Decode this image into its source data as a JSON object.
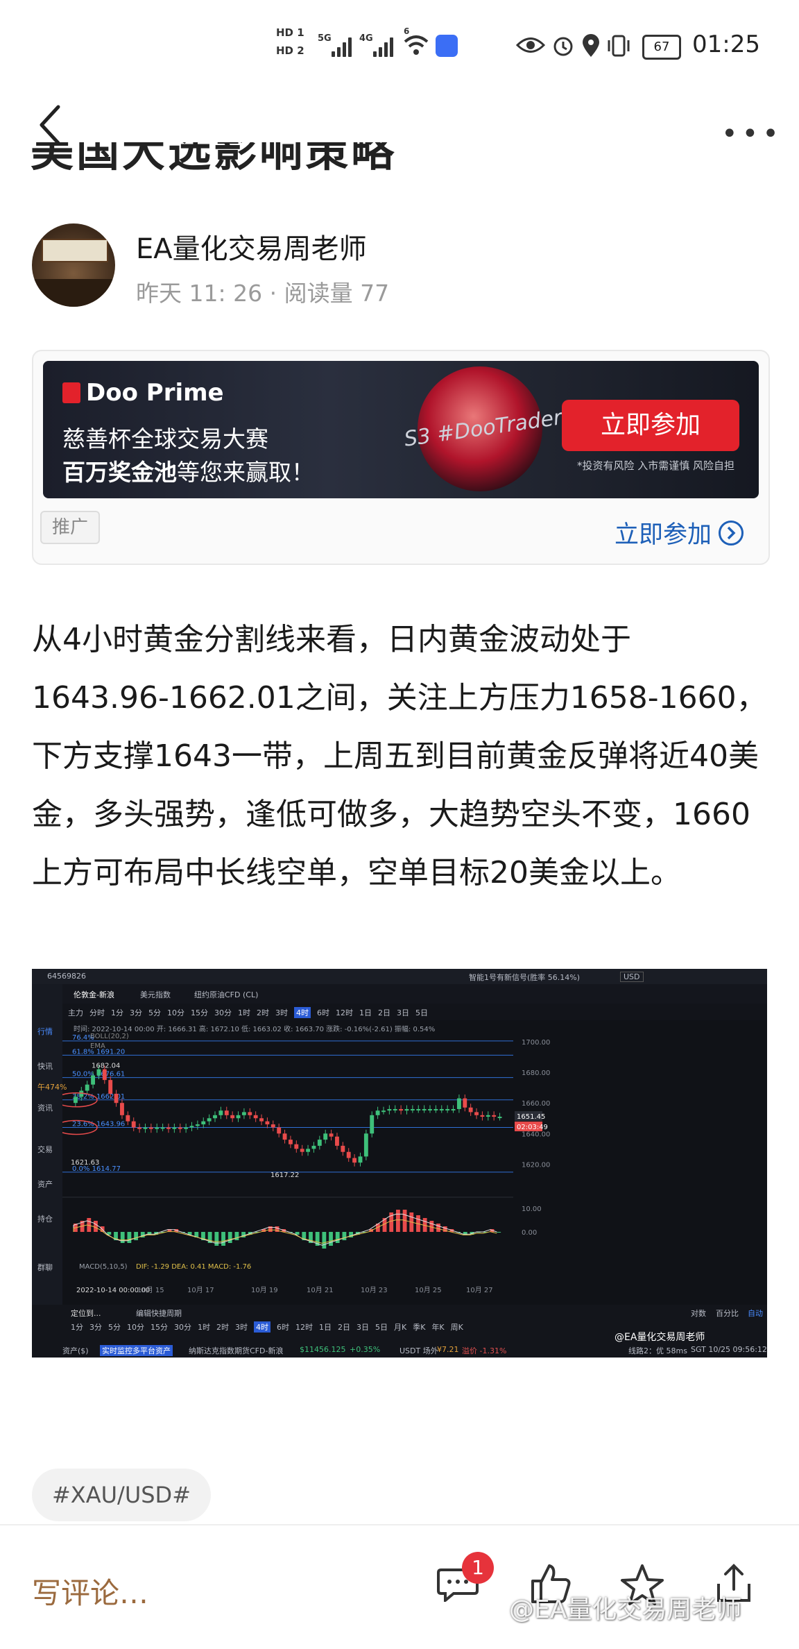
{
  "status_bar": {
    "hd1": "HD 1",
    "hd2": "HD 2",
    "net1": "5G",
    "net2": "4G",
    "wifi": "6",
    "battery": "67",
    "time": "01:25"
  },
  "nav": {
    "back_icon": "chevron-left-icon",
    "more_icon": "more-dots-icon"
  },
  "title_fragment": "美国大选影响策略",
  "author": {
    "name": "EA量化交易周老师",
    "date": "昨天 11: 26",
    "reads": "阅读量 77",
    "separator": "·"
  },
  "ad": {
    "brand": "Doo Prime",
    "line1": "慈善杯全球交易大赛",
    "line2_bold": "百万奖金池",
    "line2_rest": "等您来赢取！",
    "hashtag": "S3 #DooTrader",
    "join_button": "立即参加",
    "risk": "*投资有风险 入市需谨慎 风险自担",
    "promo_label": "推广",
    "cta": "立即参加"
  },
  "article": {
    "text": "从4小时黄金分割线来看，日内黄金波动处于1643.96-1662.01之间，关注上方压力1658-1660，下方支撑1643一带，上周五到目前黄金反弹将近40美金，多头强势，逢低可做多，大趋势空头不变，1660上方可布局中长线空单，空单目标20美金以上。"
  },
  "trading_screenshot": {
    "account": "64569826",
    "signal": "智能1号有新信号(胜率 56.14%)",
    "currency": "USD",
    "tabs": [
      "伦敦金-新浪",
      "美元指数",
      "纽约原油CFD (CL)"
    ],
    "side_items": [
      "行情",
      "快讯",
      "资讯",
      "交易",
      "资产",
      "持仓",
      "群聊"
    ],
    "side_note": "午474%",
    "timeframes": [
      "主力",
      "分时",
      "1分",
      "3分",
      "5分",
      "10分",
      "15分",
      "30分",
      "1时",
      "2时",
      "3时",
      "4时",
      "6时",
      "12时",
      "1日",
      "2日",
      "3日",
      "5日"
    ],
    "active_tf": "4时",
    "ohlc": "时间: 2022-10-14 00:00  开: 1666.31  高: 1672.10  低: 1663.02  收: 1663.70  涨跌: -0.16%(-2.61)  振幅: 0.54%",
    "indicators": [
      "BOLL(20,2)",
      "EMA"
    ],
    "fib_levels": [
      "76.4%",
      "61.8% 1691.20",
      "50.0% 1676.61",
      "38.2% 1662.01",
      "23.6% 1643.96",
      "0.0% 1614.77"
    ],
    "price_labels": [
      "1682.04",
      "1621.63",
      "1617.22"
    ],
    "y_axis": [
      "1700.00",
      "1680.00",
      "1660.00",
      "1640.00",
      "1620.00"
    ],
    "current_price": "1651.45",
    "countdown": "02:03:49",
    "macd_label": "MACD(5,10,5)",
    "macd_values": "DIF: -1.29  DEA: 0.41  MACD: -1.76",
    "macd_axis": [
      "10.00",
      "0.00"
    ],
    "x_axis": [
      "2022-10-14 00:00:00",
      "10月 15",
      "10月 17",
      "10月 19",
      "10月 21",
      "10月 23",
      "10月 25",
      "10月 27"
    ],
    "bottom_tfs": [
      "1分",
      "3分",
      "5分",
      "10分",
      "15分",
      "30分",
      "1时",
      "2时",
      "3时",
      "4时",
      "6时",
      "12时",
      "1日",
      "2日",
      "3日",
      "5日",
      "月K",
      "季K",
      "年K",
      "周K"
    ],
    "bottom_left": "定位到...",
    "bottom_hint": "编辑快捷周期",
    "log_label": "对数",
    "percent_label": "百分比",
    "auto_label": "自动",
    "watermark": "@EA量化交易周老师",
    "asset_label": "资产($)",
    "asset_btn": "实时监控多平台资产",
    "ticker": "纳斯达克指数期货CFD-新浪",
    "ticker_price": "$11456.125",
    "ticker_change": "+0.35%",
    "usdt": "USDT 场外",
    "usdt_price": "¥7.21",
    "usdt_change": "溢价 -1.31%",
    "line_info": "线路2：优 58ms",
    "sgt": "SGT 10/25 09:56:12"
  },
  "tag": "#XAU/USD#",
  "bottom_bar": {
    "comment_placeholder": "写评论…",
    "comment_count": "1",
    "watermark": "@EA量化交易周老师"
  },
  "colors": {
    "brand_red": "#e3222b",
    "link_blue": "#1e60b8",
    "comment_brown": "#9b6a3e",
    "badge_red": "#e6333b"
  }
}
